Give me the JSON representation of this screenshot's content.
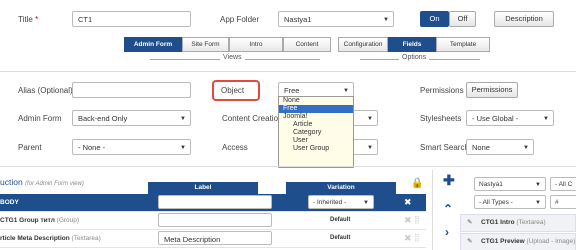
{
  "row1": {
    "title_label": "Title",
    "title_required": "*",
    "title_value": "CT1",
    "app_folder_label": "App Folder",
    "app_folder_value": "Nastya1",
    "on_label": "On",
    "off_label": "Off",
    "description_label": "Description"
  },
  "tabs_views": [
    "Admin Form",
    "Site Form",
    "Intro",
    "Content"
  ],
  "tabs_options": [
    "Configuration",
    "Fields",
    "Template"
  ],
  "views_caption": "Views",
  "options_caption": "Options",
  "form": {
    "alias_label": "Alias (Optional)",
    "object_label": "Object",
    "object_value": "Free",
    "permissions_label": "Permissions",
    "permissions_button": "Permissions",
    "admin_form_label": "Admin Form",
    "admin_form_value": "Back-end Only",
    "content_creation_label": "Content Creation",
    "stylesheets_label": "Stylesheets",
    "stylesheets_value": "- Use Global -",
    "parent_label": "Parent",
    "parent_value": "- None -",
    "access_label": "Access",
    "smart_search_label": "Smart Search",
    "smart_search_value": "None"
  },
  "object_options": [
    {
      "label": "None",
      "indent": false,
      "selected": false
    },
    {
      "label": "Free",
      "indent": false,
      "selected": true
    },
    {
      "label": "Joomla!",
      "indent": false,
      "selected": false
    },
    {
      "label": "Article",
      "indent": true,
      "selected": false
    },
    {
      "label": "Category",
      "indent": true,
      "selected": false
    },
    {
      "label": "User",
      "indent": true,
      "selected": false
    },
    {
      "label": "User Group",
      "indent": true,
      "selected": false
    }
  ],
  "table": {
    "section_title": "uction",
    "section_note": "(for Admin Form view)",
    "label_header": "Label",
    "variation_header": "Variation",
    "body_label": "BODY",
    "variation_value": "- Inherited -",
    "rows": [
      {
        "name": "CTG1 Group титл",
        "type": "(Group)",
        "label": "",
        "variation": "Default"
      },
      {
        "name": "rticle Meta Description",
        "type": "(Textarea)",
        "label": "Meta Description",
        "variation": "Default"
      }
    ]
  },
  "right_panel": {
    "folder_value": "Nastya1",
    "all_c_value": "- All C",
    "types_value": "- All Types -",
    "hash_value": "#",
    "items": [
      {
        "name": "CTG1 Intro",
        "type": "(Textarea)"
      },
      {
        "name": "CTG1 Preview",
        "type": "(Upload - Image)"
      }
    ]
  },
  "colors": {
    "primary": "#1f4e8c",
    "highlight": "#e24a3a",
    "selected": "#3370c5"
  }
}
